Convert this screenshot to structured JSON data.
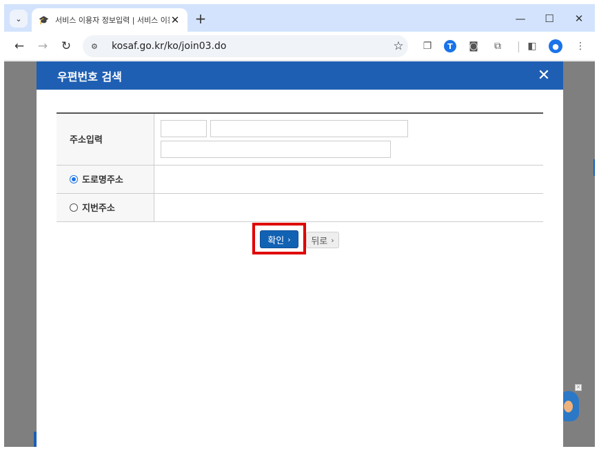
{
  "browser": {
    "tab_title": "서비스 이용자 정보입력 | 서비스 이용",
    "url": "kosaf.go.kr/ko/join03.do",
    "new_tab": "+",
    "t_badge": "T"
  },
  "modal": {
    "title": "우편번호 검색",
    "rows": [
      {
        "label": "주소입력"
      },
      {
        "label": "도로명주소",
        "type": "radio",
        "checked": true
      },
      {
        "label": "지번주소",
        "type": "radio",
        "checked": false
      }
    ],
    "inputs": {
      "zip": "",
      "address1": "",
      "address2": ""
    },
    "confirm_label": "확인",
    "back_label": "뒤로"
  },
  "icons": {
    "chevron": "›",
    "close": "✕",
    "widget_close": "✕"
  }
}
